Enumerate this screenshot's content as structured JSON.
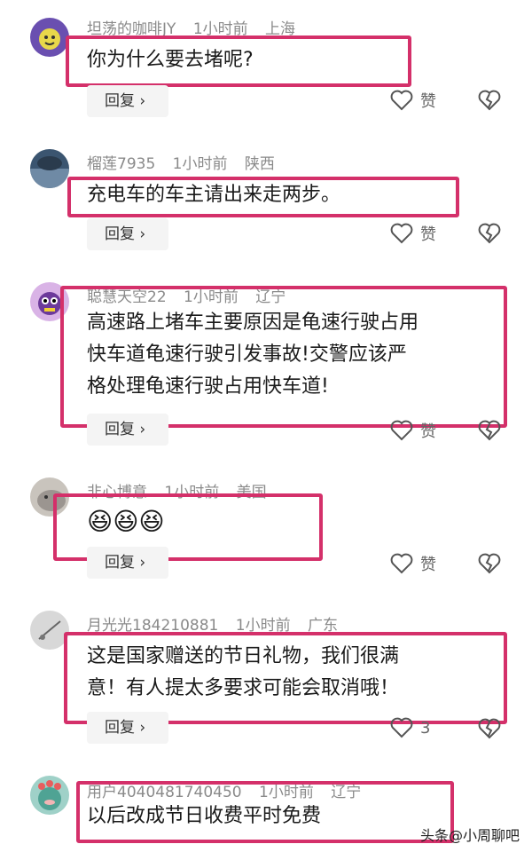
{
  "comments": [
    {
      "user": "坦荡的咖啡JY",
      "time": "1小时前",
      "loc": "上海",
      "text": [
        "你为什么要去堵呢?"
      ],
      "reply": "回复",
      "like": "赞"
    },
    {
      "user": "榴莲7935",
      "time": "1小时前",
      "loc": "陕西",
      "text": [
        "充电车的车主请出来走两步。"
      ],
      "reply": "回复",
      "like": "赞"
    },
    {
      "user": "聪慧天空22",
      "time": "1小时前",
      "loc": "辽宁",
      "text": [
        "高速路上堵车主要原因是龟速行驶占用",
        "快车道龟速行驶引发事故!交警应该严",
        "格处理龟速行驶占用快车道!"
      ],
      "reply": "回复",
      "like": "赞"
    },
    {
      "user": "非心博意",
      "time": "1小时前",
      "loc": "美国",
      "text": [
        "😆😆😆"
      ],
      "reply": "回复",
      "like": "赞"
    },
    {
      "user": "月光光184210881",
      "time": "1小时前",
      "loc": "广东",
      "text": [
        "这是国家赠送的节日礼物，我们很满",
        "意！有人提太多要求可能会取消哦！"
      ],
      "reply": "回复",
      "like": "3"
    },
    {
      "user": "用户4040481740450",
      "time": "1小时前",
      "loc": "辽宁",
      "text": [
        "以后改成节日收费平时免费"
      ],
      "reply": "",
      "like": ""
    }
  ],
  "watermark": "头条@小周聊吧",
  "colors": {
    "highlight": "#d4306a",
    "meta": "#8a8a8a",
    "reply_bg": "#f4f4f4"
  }
}
